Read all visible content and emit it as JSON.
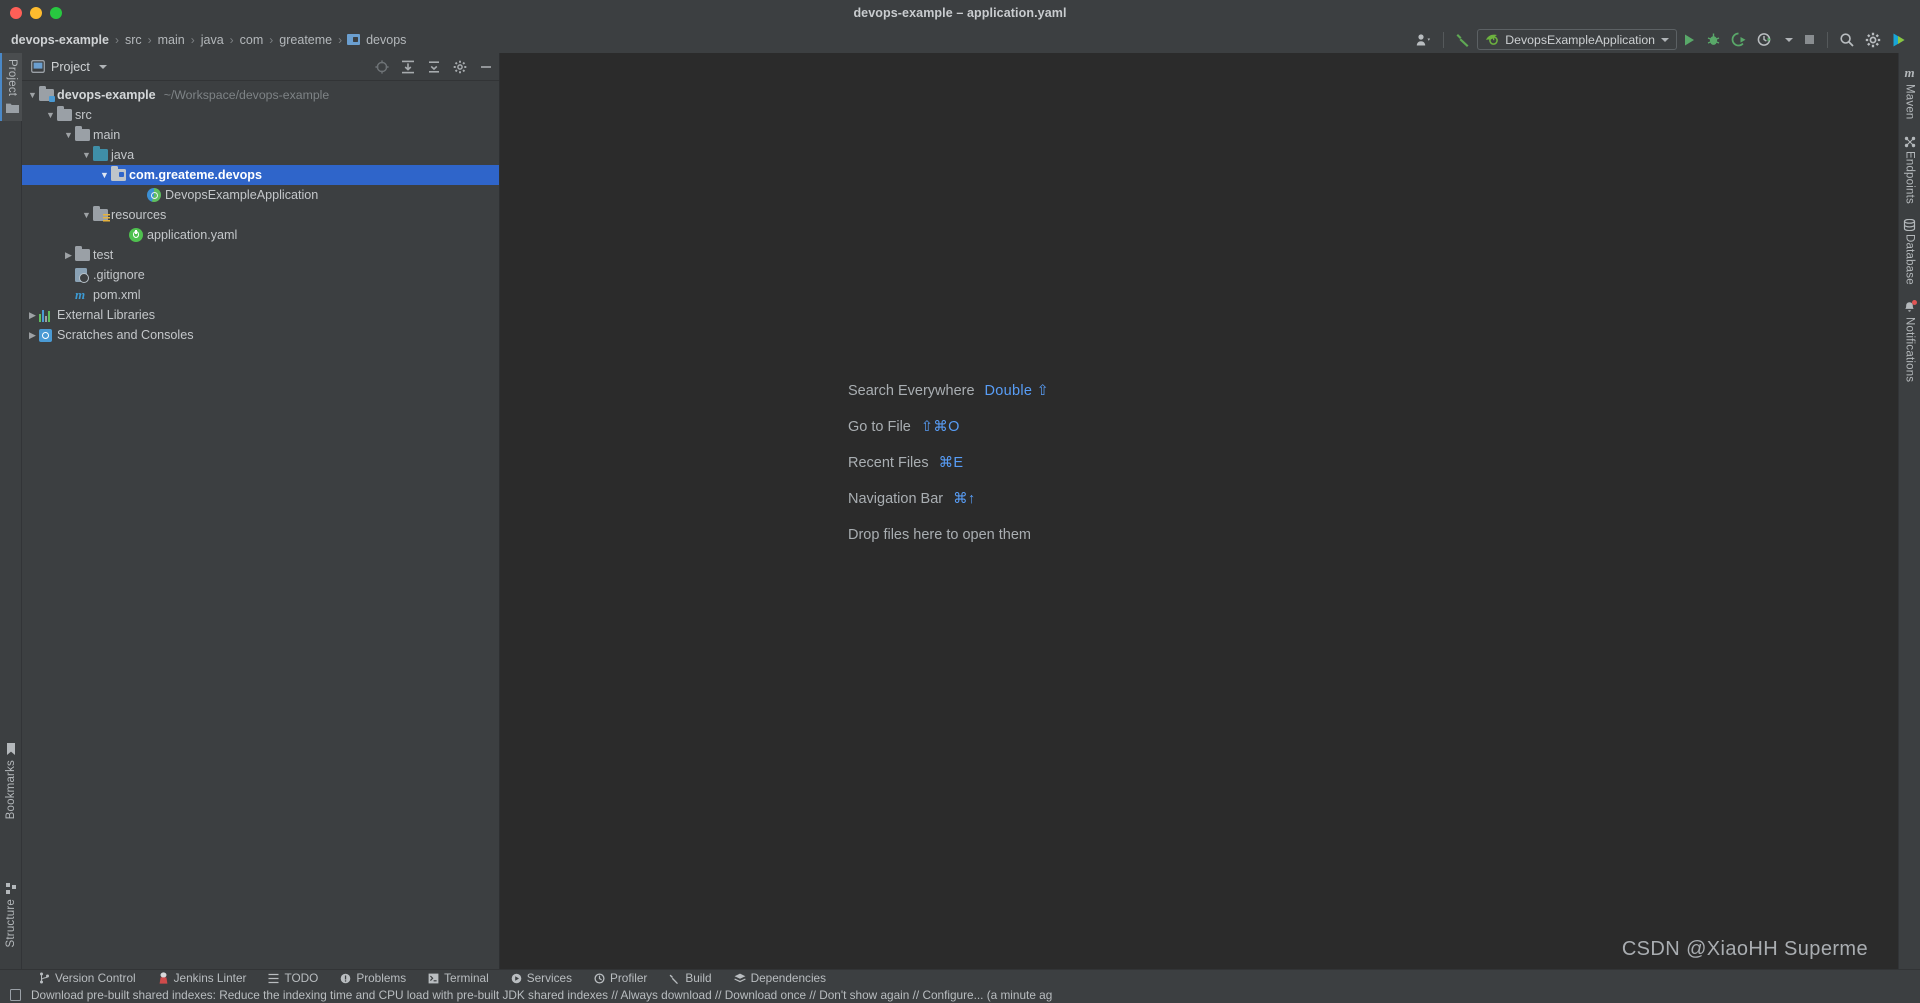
{
  "window": {
    "title": "devops-example – application.yaml",
    "traffic_lights": [
      "close",
      "minimize",
      "maximize"
    ]
  },
  "breadcrumb": {
    "items": [
      "devops-example",
      "src",
      "main",
      "java",
      "com",
      "greateme",
      "devops"
    ],
    "separator": "›"
  },
  "toolbar": {
    "user_icon": "user-accounts-icon",
    "build_label": "Build",
    "run_config": "DevopsExampleApplication",
    "run_label": "Run",
    "debug_label": "Debug",
    "coverage_label": "Run with Coverage",
    "profiler_label": "Profiler",
    "stop_label": "Stop",
    "search_label": "Search",
    "settings_label": "Settings",
    "ai_label": "AI Assistant"
  },
  "left_strip": {
    "items": [
      {
        "label": "Project",
        "active": true
      },
      {
        "label": "Bookmarks",
        "active": false
      },
      {
        "label": "Structure",
        "active": false
      }
    ]
  },
  "right_strip": {
    "items": [
      {
        "label": "Maven",
        "icon": "maven-icon",
        "badge": false
      },
      {
        "label": "Endpoints",
        "icon": "endpoints-icon",
        "badge": false
      },
      {
        "label": "Database",
        "icon": "database-icon",
        "badge": false
      },
      {
        "label": "Notifications",
        "icon": "bell-icon",
        "badge": true
      }
    ]
  },
  "project_panel": {
    "title": "Project",
    "header_icons": [
      "select-opened-file-icon",
      "expand-all-icon",
      "collapse-all-icon",
      "settings-icon",
      "hide-icon"
    ],
    "tree": [
      {
        "label": "devops-example",
        "path": "~/Workspace/devops-example",
        "indent": 0,
        "arrow": "down",
        "icon": "module-folder",
        "bold": true,
        "selected": false
      },
      {
        "label": "src",
        "indent": 1,
        "arrow": "down",
        "icon": "folder",
        "selected": false
      },
      {
        "label": "main",
        "indent": 2,
        "arrow": "down",
        "icon": "folder",
        "selected": false
      },
      {
        "label": "java",
        "indent": 3,
        "arrow": "down",
        "icon": "source-folder",
        "selected": false
      },
      {
        "label": "com.greateme.devops",
        "indent": 4,
        "arrow": "down",
        "icon": "package",
        "selected": true
      },
      {
        "label": "DevopsExampleApplication",
        "indent": 5,
        "arrow": "none",
        "icon": "spring-class",
        "selected": false
      },
      {
        "label": "resources",
        "indent": 3,
        "arrow": "down",
        "icon": "resources-folder",
        "selected": false
      },
      {
        "label": "application.yaml",
        "indent": 4,
        "arrow": "none",
        "icon": "spring-yaml",
        "selected": false
      },
      {
        "label": "test",
        "indent": 2,
        "arrow": "right",
        "icon": "folder",
        "selected": false
      },
      {
        "label": ".gitignore",
        "indent": 2,
        "arrow": "none",
        "icon": "gitignore",
        "selected": false
      },
      {
        "label": "pom.xml",
        "indent": 2,
        "arrow": "none",
        "icon": "maven-file",
        "selected": false
      },
      {
        "label": "External Libraries",
        "indent": 0,
        "arrow": "right",
        "icon": "libraries",
        "selected": false
      },
      {
        "label": "Scratches and Consoles",
        "indent": 0,
        "arrow": "right",
        "icon": "scratches",
        "selected": false
      }
    ]
  },
  "editor": {
    "shortcuts": [
      {
        "label": "Search Everywhere",
        "keys": "Double ⇧"
      },
      {
        "label": "Go to File",
        "keys": "⇧⌘O"
      },
      {
        "label": "Recent Files",
        "keys": "⌘E"
      },
      {
        "label": "Navigation Bar",
        "keys": "⌘↑"
      }
    ],
    "drop_hint": "Drop files here to open them"
  },
  "watermark": "CSDN @XiaoHH Superme",
  "bottom_bar": {
    "items": [
      {
        "label": "Version Control",
        "icon": "branch-icon"
      },
      {
        "label": "Jenkins Linter",
        "icon": "jenkins-icon"
      },
      {
        "label": "TODO",
        "icon": "list-icon"
      },
      {
        "label": "Problems",
        "icon": "warning-icon"
      },
      {
        "label": "Terminal",
        "icon": "terminal-icon"
      },
      {
        "label": "Services",
        "icon": "play-circle-icon"
      },
      {
        "label": "Profiler",
        "icon": "profiler-icon"
      },
      {
        "label": "Build",
        "icon": "hammer-icon"
      },
      {
        "label": "Dependencies",
        "icon": "layers-icon"
      }
    ]
  },
  "status_bar": {
    "icon": "notification-log-icon",
    "message": "Download pre-built shared indexes: Reduce the indexing time and CPU load with pre-built JDK shared indexes // Always download // Download once // Don't show again // Configure... (a minute ag"
  },
  "colors": {
    "bg_panel": "#3c3f41",
    "bg_editor": "#2b2b2b",
    "selection": "#2f65ca",
    "accent_link": "#589df6",
    "text": "#b9bdc0"
  }
}
